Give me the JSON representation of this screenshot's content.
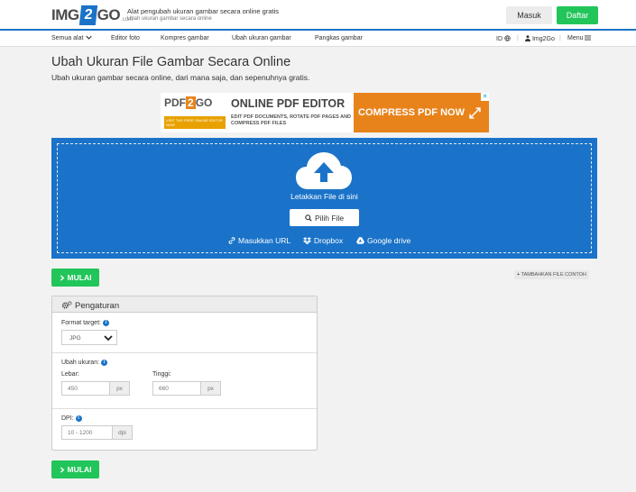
{
  "header": {
    "logo_left": "IMG",
    "logo_num": "2",
    "logo_right": "GO",
    "logo_com": ".com",
    "tagline": "Alat pengubah ukuran gambar secara online gratis",
    "subtagline": "Ubah ukuran gambar secara online",
    "login": "Masuk",
    "signup": "Daftar",
    "accent": "#1a73c8",
    "green": "#21c55a"
  },
  "nav": {
    "items": [
      "Semua alat",
      "Editor foto",
      "Kompres gambar",
      "Ubah ukuran gambar",
      "Pangkas gambar"
    ],
    "lang": "ID",
    "brand": "Img2Go",
    "menu": "Menu"
  },
  "page": {
    "title": "Ubah Ukuran File Gambar Secara Online",
    "subtitle": "Ubah ukuran gambar secara online, dari mana saja, dan sepenuhnya gratis."
  },
  "ad": {
    "logo_left": "PDF",
    "logo_num": "2",
    "logo_right": "GO",
    "visit": "VISIT THE FREE ONLINE EDITOR NOW",
    "title": "ONLINE PDF EDITOR",
    "desc": "EDIT PDF DOCUMENTS, ROTATE PDF PAGES AND COMPRESS PDF FILES",
    "cta": "COMPRESS PDF NOW",
    "orange": "#e8831b"
  },
  "upload": {
    "drop_text": "Letakkan File di sini",
    "choose": "Pilih File",
    "url": "Masukkan URL",
    "dropbox": "Dropbox",
    "gdrive": "Google drive"
  },
  "actions": {
    "start": "MULAI",
    "sample": "TAMBAHKAN FILE CONTOH"
  },
  "settings": {
    "title": "Pengaturan",
    "format_label": "Format target:",
    "format_value": "JPG",
    "resize_label": "Ubah ukuran:",
    "width_label": "Lebar:",
    "width_placeholder": "450",
    "height_label": "Tinggi:",
    "height_placeholder": "660",
    "unit_px": "px",
    "dpi_label": "DPI:",
    "dpi_placeholder": "10 - 1200",
    "unit_dpi": "dpi"
  }
}
